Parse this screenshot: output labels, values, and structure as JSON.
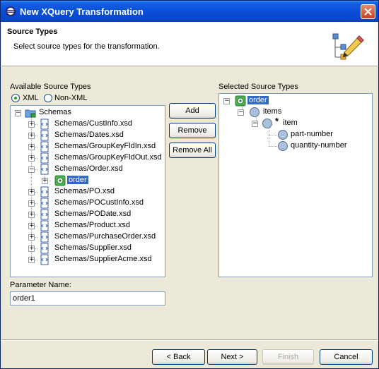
{
  "window": {
    "title": "New XQuery Transformation",
    "icon": "eclipse-icon"
  },
  "header": {
    "title": "Source Types",
    "description": "Select source types for the transformation.",
    "icon": "tree-pencil-icon"
  },
  "available": {
    "label": "Available Source Types",
    "xml_label": "XML",
    "nonxml_label": "Non-XML",
    "xml_selected": true,
    "root": "Schemas",
    "items": [
      "Schemas/CustInfo.xsd",
      "Schemas/Dates.xsd",
      "Schemas/GroupKeyFldIn.xsd",
      "Schemas/GroupKeyFldOut.xsd",
      "Schemas/Order.xsd",
      "order",
      "Schemas/PO.xsd",
      "Schemas/POCustInfo.xsd",
      "Schemas/PODate.xsd",
      "Schemas/Product.xsd",
      "Schemas/PurchaseOrder.xsd",
      "Schemas/Supplier.xsd",
      "Schemas/SupplierAcme.xsd"
    ]
  },
  "actions": {
    "add": "Add",
    "remove": "Remove",
    "remove_all": "Remove All"
  },
  "selected": {
    "label": "Selected Source Types",
    "root": "order",
    "items": "items",
    "item": "item",
    "item_marker": "*",
    "part_number": "part-number",
    "quantity_number": "quantity-number"
  },
  "parameter": {
    "label": "Parameter Name:",
    "value": "order1"
  },
  "footer": {
    "back": "< Back",
    "next": "Next >",
    "finish": "Finish",
    "cancel": "Cancel"
  }
}
